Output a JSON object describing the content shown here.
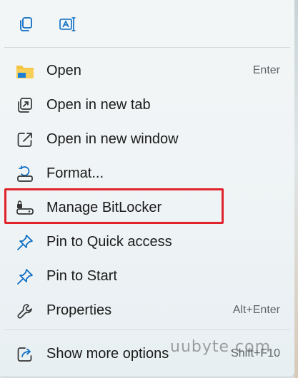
{
  "toolbar": {
    "copy_icon": "copy-icon",
    "rename_icon": "rename-icon"
  },
  "menu": {
    "items": [
      {
        "label": "Open",
        "shortcut": "Enter",
        "icon": "folder-icon"
      },
      {
        "label": "Open in new tab",
        "shortcut": "",
        "icon": "open-new-tab-icon"
      },
      {
        "label": "Open in new window",
        "shortcut": "",
        "icon": "open-new-window-icon"
      },
      {
        "label": "Format...",
        "shortcut": "",
        "icon": "format-icon"
      },
      {
        "label": "Manage BitLocker",
        "shortcut": "",
        "icon": "bitlocker-key-icon"
      },
      {
        "label": "Pin to Quick access",
        "shortcut": "",
        "icon": "pin-icon"
      },
      {
        "label": "Pin to Start",
        "shortcut": "",
        "icon": "pin-icon"
      },
      {
        "label": "Properties",
        "shortcut": "Alt+Enter",
        "icon": "wrench-icon"
      },
      {
        "label": "Show more options",
        "shortcut": "Shift+F10",
        "icon": "share-icon"
      }
    ]
  },
  "watermark": "uubyte.com",
  "colors": {
    "accent_blue": "#0a6cc4",
    "highlight_red": "#e0222a",
    "folder_yellow": "#f5c542"
  }
}
